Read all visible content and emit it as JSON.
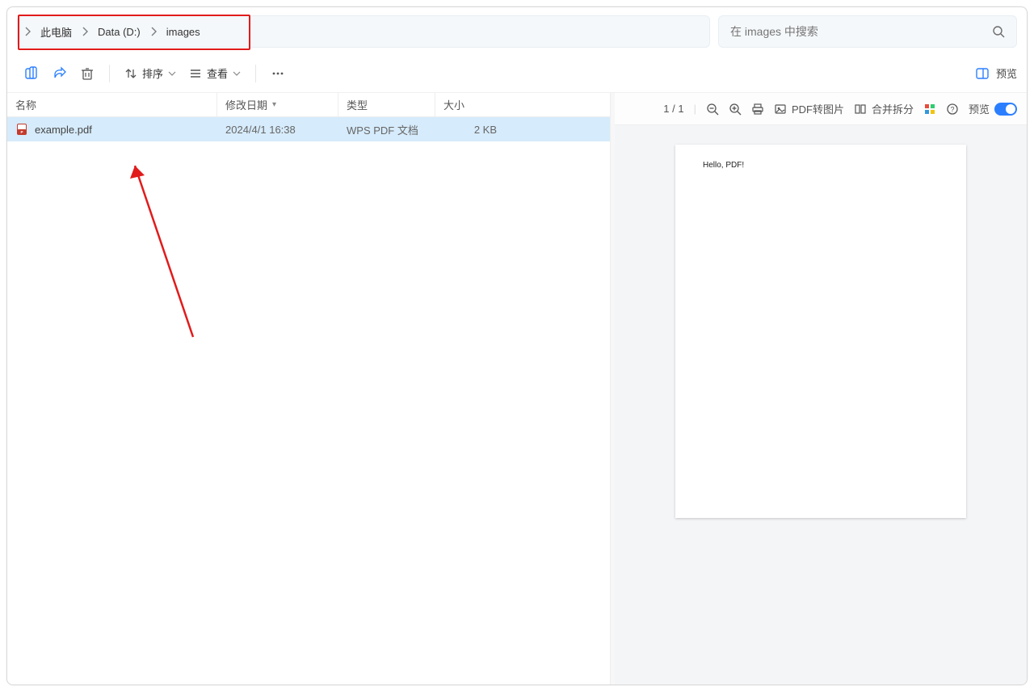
{
  "breadcrumbs": {
    "p0": "此电脑",
    "p1": "Data (D:)",
    "p2": "images"
  },
  "search": {
    "placeholder": "在 images 中搜索"
  },
  "toolbar": {
    "sort": "排序",
    "view": "查看",
    "preview": "预览"
  },
  "cols": {
    "name": "名称",
    "date": "修改日期",
    "type": "类型",
    "size": "大小"
  },
  "rows": [
    {
      "name": "example.pdf",
      "date": "2024/4/1 16:38",
      "type": "WPS PDF 文档",
      "size": "2 KB"
    }
  ],
  "preview_toolbar": {
    "pages": "1 / 1",
    "pdf2img": "PDF转图片",
    "mergesplit": "合并拆分",
    "preview_label": "预览"
  },
  "preview_content": "Hello, PDF!"
}
